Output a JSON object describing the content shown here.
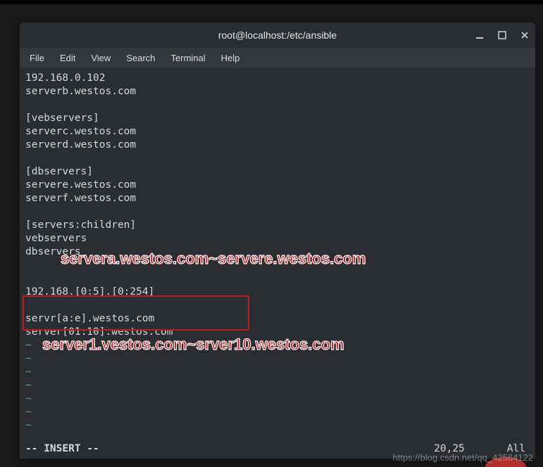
{
  "window": {
    "title": "root@localhost:/etc/ansible"
  },
  "menubar": {
    "items": [
      "File",
      "Edit",
      "View",
      "Search",
      "Terminal",
      "Help"
    ]
  },
  "terminal": {
    "lines": [
      "192.168.0.102",
      "serverb.westos.com",
      "",
      "[vebservers]",
      "serverc.westos.com",
      "serverd.westos.com",
      "",
      "[dbservers]",
      "servere.westos.com",
      "serverf.westos.com",
      "",
      "[servers:children]",
      "vebservers",
      "dbservers",
      "",
      "",
      "192.168.[0:5].[0:254]",
      "",
      "servr[a:e].westos.com",
      "server[01:10].westos.com"
    ],
    "tilde_lines": [
      "~",
      "~",
      "~",
      "~",
      "~",
      "~",
      "~"
    ]
  },
  "status": {
    "mode": "-- INSERT --",
    "position": "20,25",
    "percent": "All"
  },
  "annotations": {
    "a1": "servera.westos.com~servere.westos.com",
    "a2": "server1.vestos.com~srver10.westos.com"
  },
  "watermark": "https://blog.csdn.net/qq_42564122"
}
